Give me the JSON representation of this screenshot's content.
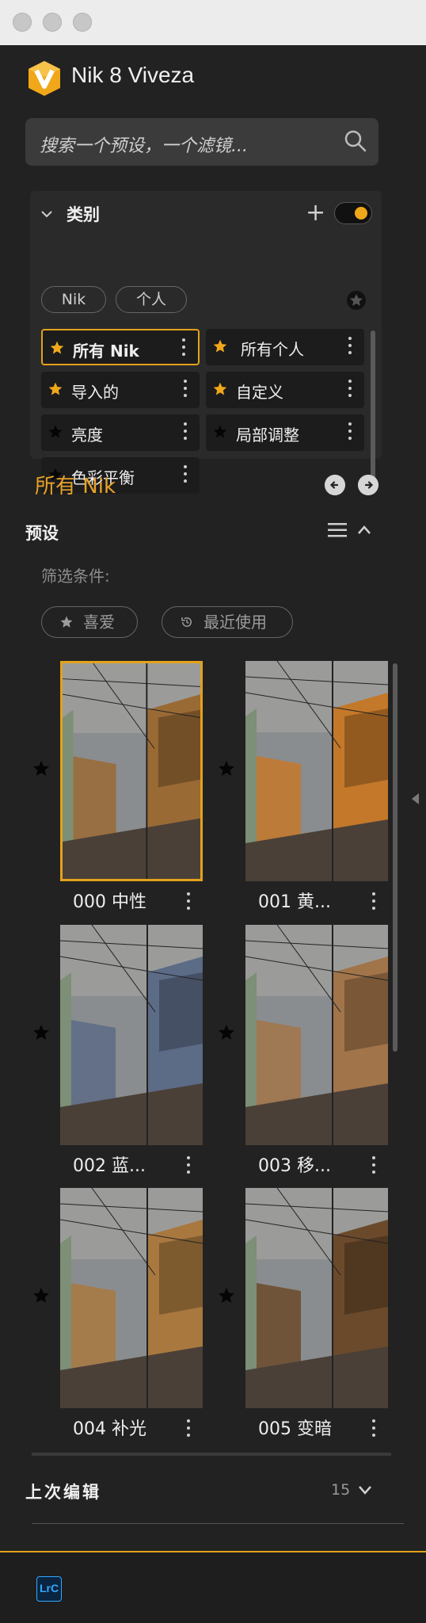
{
  "app": {
    "name": "Nik 8 Viveza"
  },
  "search": {
    "placeholder": "搜索一个预设，一个滤镜..."
  },
  "categories": {
    "title": "类别",
    "chips": [
      "Nik",
      "个人"
    ],
    "items": [
      {
        "label": "所有 Nik",
        "star": "gold",
        "selected": true
      },
      {
        "label": "所有个人",
        "star": "gold",
        "selected": false
      },
      {
        "label": "导入的",
        "star": "gold",
        "selected": false
      },
      {
        "label": "自定义",
        "star": "gold",
        "selected": false
      },
      {
        "label": "亮度",
        "star": "dark",
        "selected": false
      },
      {
        "label": "局部调整",
        "star": "dark",
        "selected": false
      },
      {
        "label": "色彩平衡",
        "star": "dark",
        "selected": false
      }
    ]
  },
  "section": {
    "title": "所有 Nik"
  },
  "presets": {
    "label": "预设",
    "filter_label": "筛选条件:",
    "filters": [
      "喜爱",
      "最近使用"
    ],
    "items": [
      {
        "label": "000 中性",
        "tint": "#9a6a35",
        "selected": true
      },
      {
        "label": "001 黄...",
        "tint": "#c4782a",
        "selected": false
      },
      {
        "label": "002 蓝...",
        "tint": "#5c6b86",
        "selected": false
      },
      {
        "label": "003 移...",
        "tint": "#a2744a",
        "selected": false
      },
      {
        "label": "004 补光",
        "tint": "#a8783f",
        "selected": false
      },
      {
        "label": "005 变暗",
        "tint": "#6b4a2b",
        "selected": false
      }
    ]
  },
  "last_edit": {
    "label": "上次编辑",
    "count": "15"
  },
  "footer": {
    "badge": "LrC"
  },
  "colors": {
    "accent": "#e3a21b",
    "panel": "#2a2a2a",
    "background": "#222222"
  }
}
